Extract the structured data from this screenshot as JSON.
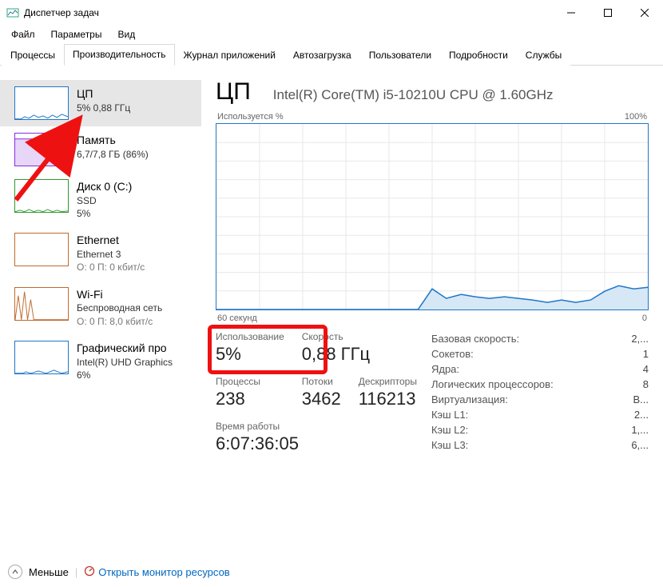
{
  "window": {
    "title": "Диспетчер задач"
  },
  "menu": {
    "file": "Файл",
    "options": "Параметры",
    "view": "Вид"
  },
  "tabs": {
    "processes": "Процессы",
    "performance": "Производительность",
    "app_history": "Журнал приложений",
    "startup": "Автозагрузка",
    "users": "Пользователи",
    "details": "Подробности",
    "services": "Службы"
  },
  "sidebar": {
    "cpu": {
      "title": "ЦП",
      "sub": "5% 0,88 ГГц"
    },
    "mem": {
      "title": "Память",
      "sub": "6,7/7,8 ГБ (86%)"
    },
    "disk": {
      "title": "Диск 0 (C:)",
      "sub1": "SSD",
      "sub2": "5%"
    },
    "eth": {
      "title": "Ethernet",
      "sub1": "Ethernet 3",
      "sub2": "О: 0 П: 0 кбит/с"
    },
    "wifi": {
      "title": "Wi-Fi",
      "sub1": "Беспроводная сеть",
      "sub2": "О: 0 П: 8,0 кбит/с"
    },
    "gpu": {
      "title": "Графический про",
      "sub1": "Intel(R) UHD Graphics",
      "sub2": "6%"
    }
  },
  "main": {
    "title": "ЦП",
    "subtitle": "Intel(R) Core(TM) i5-10210U CPU @ 1.60GHz",
    "chart_top_left": "Используется %",
    "chart_top_right": "100%",
    "chart_bottom_left": "60 секунд",
    "chart_bottom_right": "0"
  },
  "stats": {
    "usage_label": "Использование",
    "usage_value": "5%",
    "speed_label": "Скорость",
    "speed_value": "0,88 ГГц",
    "processes_label": "Процессы",
    "processes_value": "238",
    "threads_label": "Потоки",
    "threads_value": "3462",
    "handles_label": "Дескрипторы",
    "handles_value": "116213",
    "uptime_label": "Время работы",
    "uptime_value": "6:07:36:05"
  },
  "sysinfo": {
    "base_speed_l": "Базовая скорость:",
    "base_speed_v": "2,...",
    "sockets_l": "Сокетов:",
    "sockets_v": "1",
    "cores_l": "Ядра:",
    "cores_v": "4",
    "logical_l": "Логических процессоров:",
    "logical_v": "8",
    "virt_l": "Виртуализация:",
    "virt_v": "В...",
    "l1_l": "Кэш L1:",
    "l1_v": "2...",
    "l2_l": "Кэш L2:",
    "l2_v": "1,...",
    "l3_l": "Кэш L3:",
    "l3_v": "6,..."
  },
  "footer": {
    "less": "Меньше",
    "resmon": "Открыть монитор ресурсов"
  },
  "chart_data": {
    "type": "line",
    "title": "Используется %",
    "xlabel": "60 секунд",
    "ylabel": "",
    "ylim": [
      0,
      100
    ],
    "xlim": [
      0,
      60
    ],
    "x": [
      0,
      2,
      4,
      6,
      8,
      10,
      12,
      14,
      16,
      18,
      20,
      22,
      24,
      26,
      28,
      30,
      32,
      34,
      36,
      38,
      40,
      42,
      44,
      46,
      48,
      50,
      52,
      54,
      56,
      58,
      60
    ],
    "values": [
      0,
      0,
      0,
      0,
      0,
      0,
      0,
      0,
      0,
      0,
      0,
      0,
      0,
      0,
      0,
      11,
      6,
      8,
      7,
      6,
      7,
      6,
      5,
      4,
      5,
      4,
      5,
      10,
      13,
      11,
      12
    ]
  }
}
